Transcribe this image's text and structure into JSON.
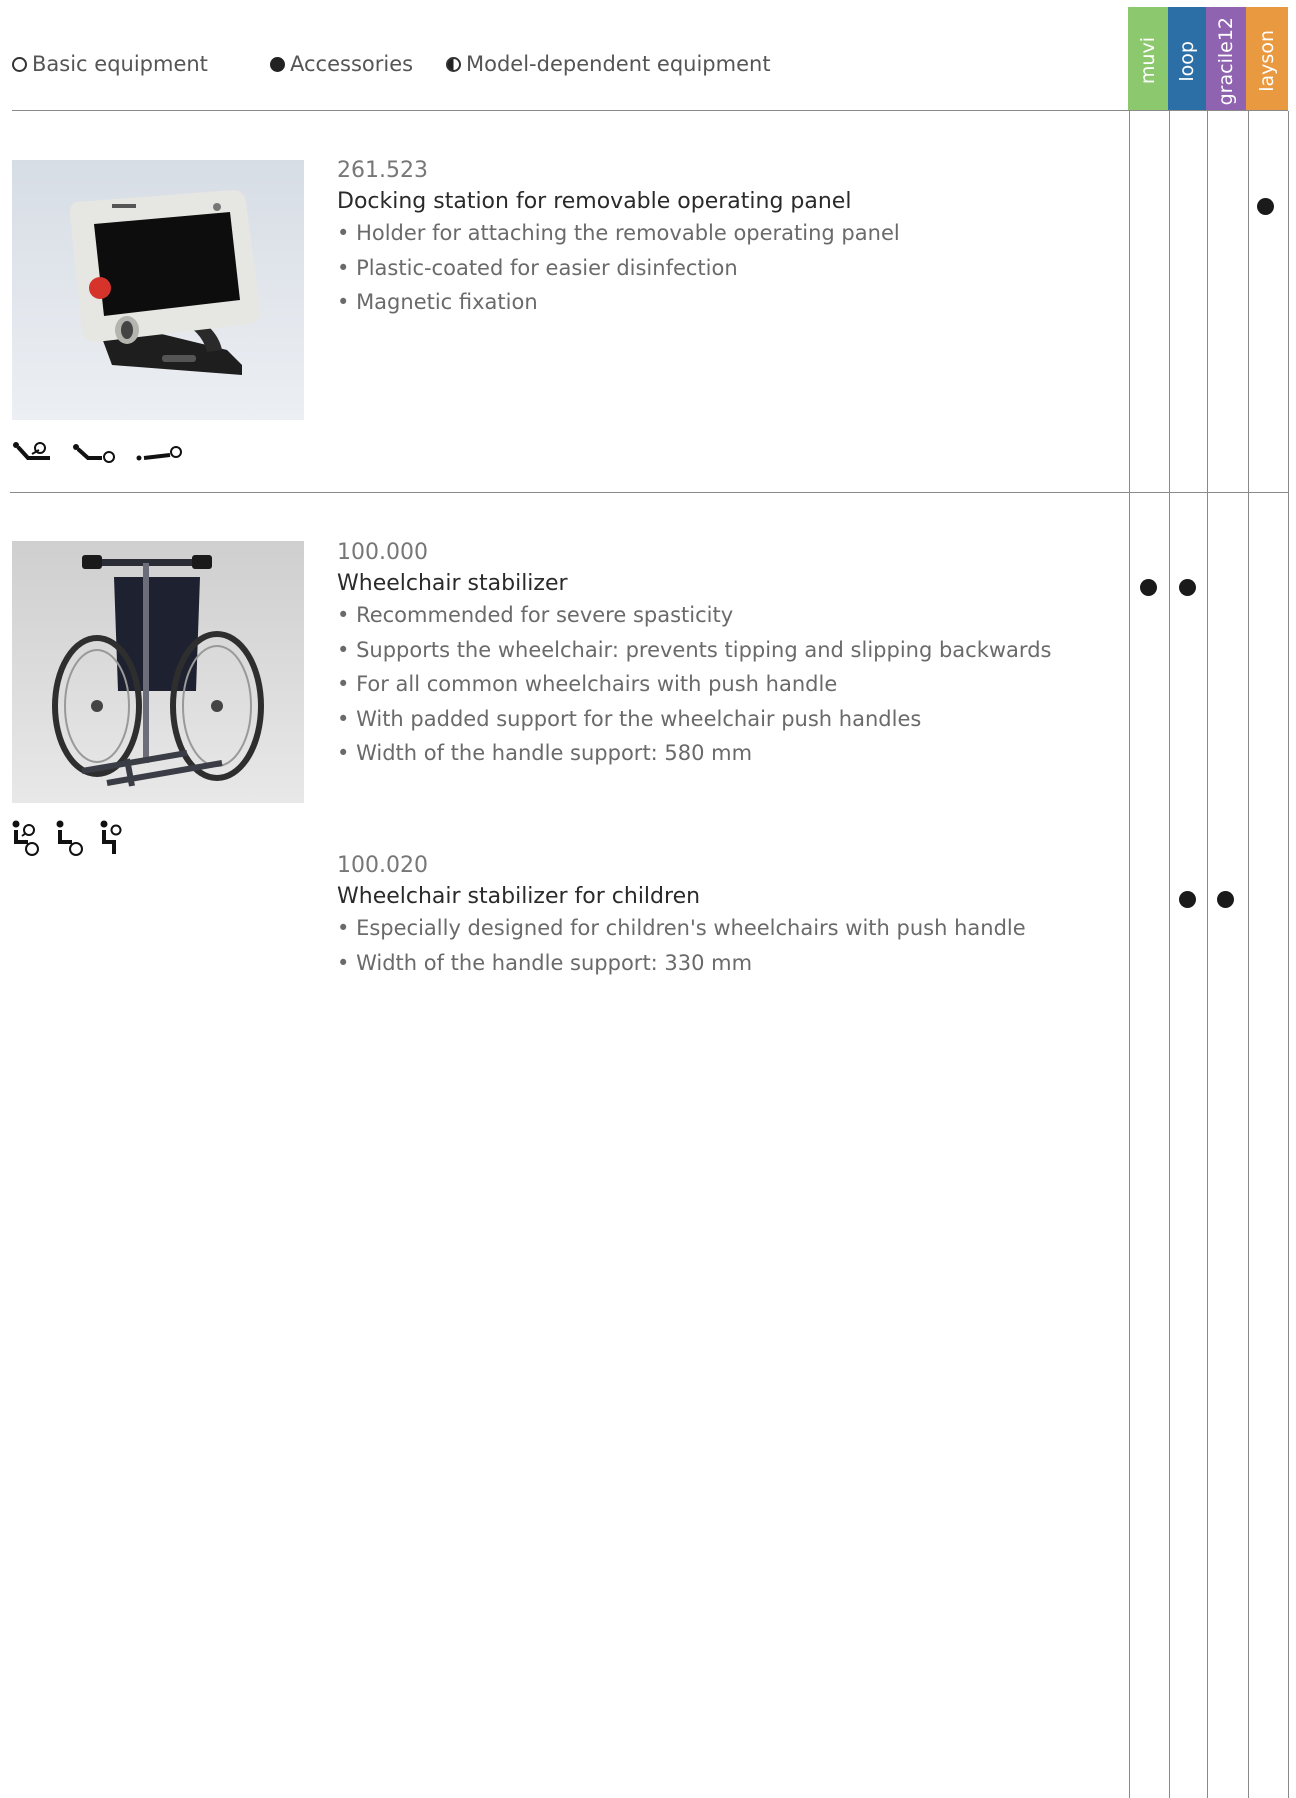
{
  "legend": {
    "basic": "Basic equipment",
    "accessories": "Accessories",
    "model_dependent": "Model-dependent equipment"
  },
  "models": [
    {
      "label": "muvi",
      "color": "#8cc96e"
    },
    {
      "label": "loop",
      "color": "#2c6fa6"
    },
    {
      "label": "gracile12",
      "color": "#8f63b0"
    },
    {
      "label": "layson",
      "color": "#e9993f"
    }
  ],
  "sections": [
    {
      "icons": [
        "reclined-patient-icon",
        "supine-patient-icon",
        "lying-flat-patient-icon"
      ],
      "products": [
        {
          "code": "261.523",
          "title": "Docking station for removable operating panel",
          "bullets": [
            "Holder for attaching the removable operating panel",
            "Plastic-coated for easier disinfection",
            "Magnetic fixation"
          ],
          "availability": {
            "muvi": "",
            "loop": "",
            "gracile12": "",
            "layson": "accessory"
          }
        }
      ]
    },
    {
      "icons": [
        "wheelchair-user-icon",
        "wheelchair-user-icon",
        "seated-user-icon"
      ],
      "products": [
        {
          "code": "100.000",
          "title": "Wheelchair stabilizer",
          "bullets": [
            "Recommended for severe spasticity",
            "Supports the wheelchair: prevents tipping and slipping backwards",
            "For all common wheelchairs with push handle",
            "With padded support for the wheelchair push handles",
            "Width of the handle support: 580 mm"
          ],
          "availability": {
            "muvi": "accessory",
            "loop": "accessory",
            "gracile12": "",
            "layson": ""
          }
        },
        {
          "code": "100.020",
          "title": "Wheelchair stabilizer for children",
          "bullets": [
            "Especially designed for children's wheelchairs with push handle",
            "Width of the handle support: 330 mm"
          ],
          "availability": {
            "muvi": "",
            "loop": "accessory",
            "gracile12": "accessory",
            "layson": ""
          }
        }
      ]
    }
  ]
}
